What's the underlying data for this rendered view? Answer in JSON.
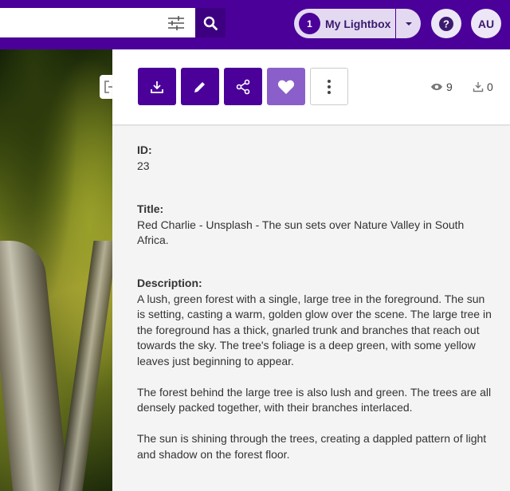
{
  "header": {
    "search": {
      "value": "",
      "placeholder": ""
    },
    "lightbox": {
      "count": "1",
      "label": "My Lightbox"
    },
    "help_symbol": "?",
    "avatar_initials": "AU"
  },
  "toolbar": {
    "views": "9",
    "downloads": "0"
  },
  "details": {
    "fields": [
      {
        "label": "ID:",
        "value": "23"
      },
      {
        "label": "Title:",
        "value": "Red Charlie - Unsplash - The sun sets over Nature Valley in South Africa."
      },
      {
        "label": "Description:",
        "value": "A lush, green forest with a single, large tree in the foreground. The sun is setting, casting a warm, golden glow over the scene. The large tree in the foreground has a thick, gnarled trunk and branches that reach out towards the sky. The tree's foliage is a deep green, with some yellow leaves just beginning to appear.\n\nThe forest behind the large tree is also lush and green. The trees are all densely packed together, with their branches interlaced.\n\nThe sun is shining through the trees, creating a dappled pattern of light and shadow on the forest floor."
      }
    ]
  },
  "colors": {
    "brand_purple": "#4a0099",
    "favorite_purple": "#8a5fc9"
  }
}
